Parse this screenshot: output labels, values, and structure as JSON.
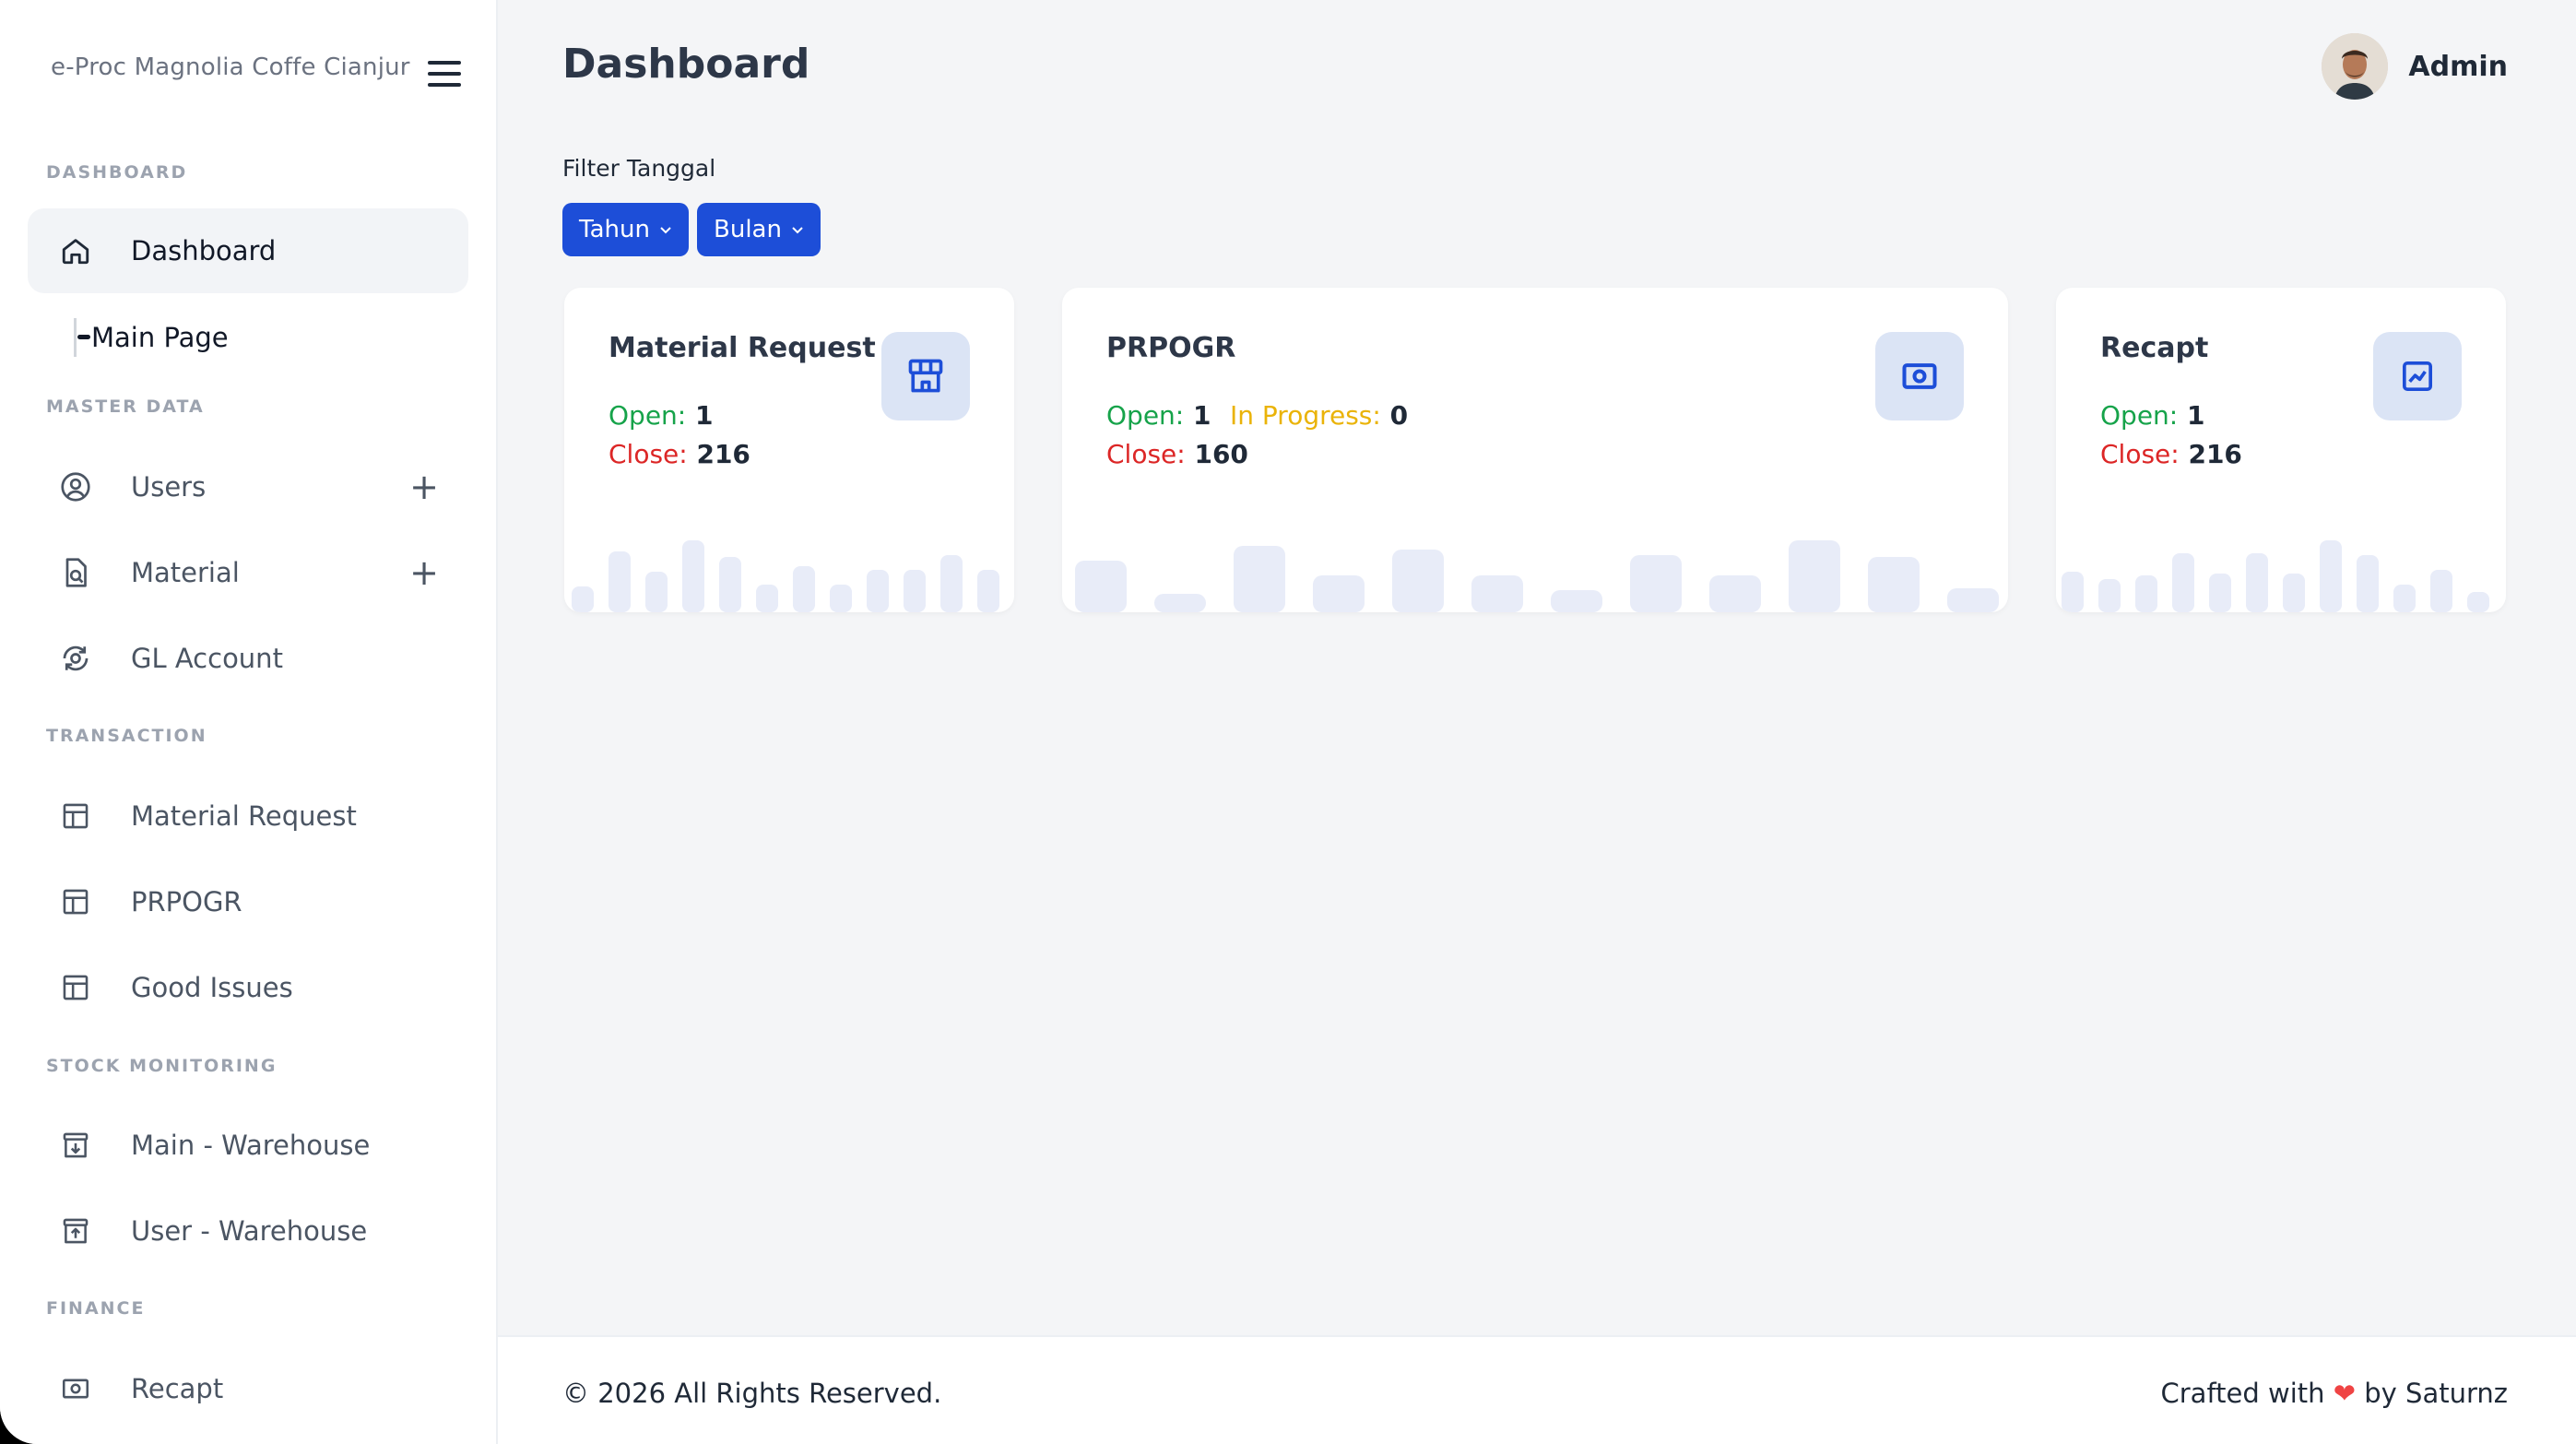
{
  "sidebar": {
    "brand": "e-Proc Magnolia Coffe Cianjur",
    "sections": {
      "dashboard": "DASHBOARD",
      "master_data": "MASTER DATA",
      "transaction": "TRANSACTION",
      "stock_monitoring": "STOCK MONITORING",
      "finance": "FINANCE"
    },
    "items": {
      "dashboard": "Dashboard",
      "main_page": "Main Page",
      "users": "Users",
      "material": "Material",
      "gl_account": "GL Account",
      "material_request": "Material Request",
      "prpogr": "PRPOGR",
      "good_issues": "Good Issues",
      "main_warehouse": "Main - Warehouse",
      "user_warehouse": "User - Warehouse",
      "recapt": "Recapt"
    },
    "expand_symbol": "+"
  },
  "header": {
    "title": "Dashboard",
    "user_name": "Admin"
  },
  "filter": {
    "label": "Filter Tanggal",
    "year_label": "Tahun",
    "month_label": "Bulan"
  },
  "cards": {
    "material_request": {
      "title": "Material Request",
      "open_label": "Open:",
      "open_value": "1",
      "close_label": "Close:",
      "close_value": "216",
      "icon": "store-icon"
    },
    "prpogr": {
      "title": "PRPOGR",
      "open_label": "Open:",
      "open_value": "1",
      "progress_label": "In Progress:",
      "progress_value": "0",
      "close_label": "Close:",
      "close_value": "160",
      "icon": "money-icon"
    },
    "recapt": {
      "title": "Recapt",
      "open_label": "Open:",
      "open_value": "1",
      "close_label": "Close:",
      "close_value": "216",
      "icon": "chart-line-icon"
    }
  },
  "footer": {
    "copyright": "© 2026 All Rights Reserved.",
    "crafted_prefix": "Crafted with",
    "crafted_suffix": "by Saturnz"
  },
  "colors": {
    "primary": "#1d4ed8",
    "open": "#16a34a",
    "close": "#dc2626",
    "in_progress": "#eab308",
    "bar": "#e8ecf8"
  }
}
